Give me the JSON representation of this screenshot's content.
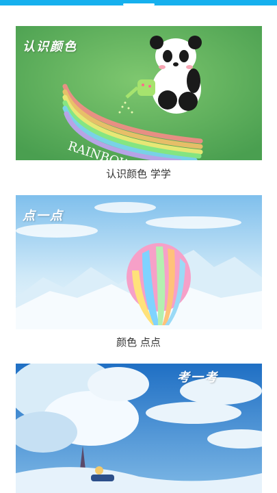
{
  "cards": [
    {
      "tag": "认识颜色",
      "caption": "认识颜色 学学",
      "art_text": "RAINBOW"
    },
    {
      "tag": "点一点",
      "caption": "颜色 点点"
    },
    {
      "tag": "考一考",
      "caption": ""
    }
  ],
  "colors": {
    "status_bar": "#16b0ee",
    "card1_bg": "#58b05f",
    "card2_sky": "#a9d6f2",
    "card3_sky": "#2f83cf"
  }
}
